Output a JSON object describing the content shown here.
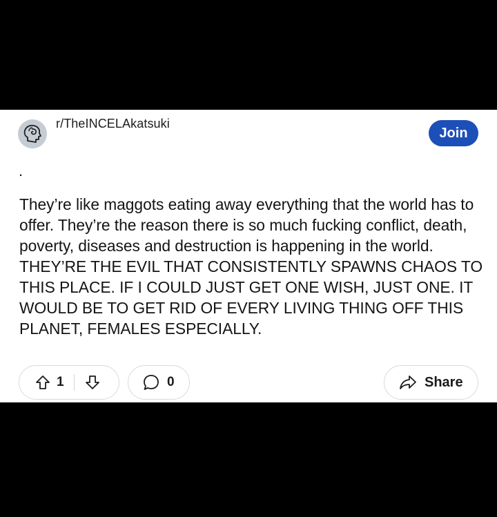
{
  "post": {
    "subreddit": "r/TheINCELAkatsuki",
    "join_label": "Join",
    "title": ".",
    "body": "They’re like maggots eating away everything that the world has to offer. They’re the reason there is so much fucking conflict, death, poverty, diseases and destruction is happening in the world. THEY’RE THE EVIL THAT CONSISTENTLY SPAWNS CHAOS TO THIS PLACE. IF I COULD JUST GET ONE WISH, JUST ONE. IT WOULD BE TO GET RID OF EVERY LIVING THING OFF THIS PLANET, FEMALES ESPECIALLY."
  },
  "actions": {
    "upvote_count": "1",
    "comment_count": "0",
    "share_label": "Share"
  },
  "icons": {
    "upvote": "upvote-arrow-icon",
    "downvote": "downvote-arrow-icon",
    "comment": "comment-bubble-icon",
    "share": "share-arrow-icon",
    "avatar": "subreddit-avatar-icon"
  },
  "colors": {
    "join_button": "#1d4fb8",
    "avatar_bg": "#c5ccd3",
    "border": "#d9dadc"
  }
}
